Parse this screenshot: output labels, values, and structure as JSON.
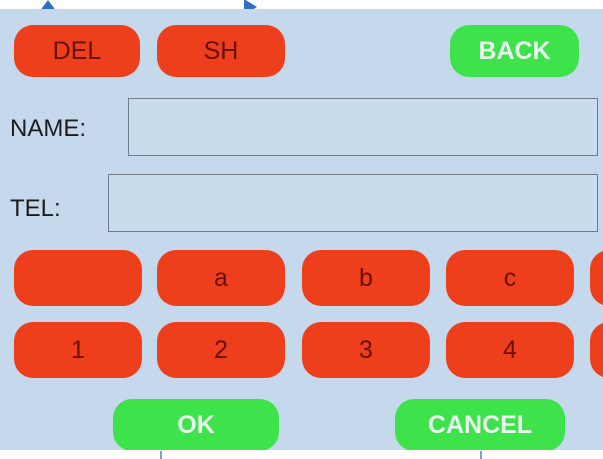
{
  "toolbar": {
    "del_label": "DEL",
    "sh_label": "SH",
    "back_label": "BACK"
  },
  "form": {
    "name_label": "NAME:",
    "name_value": "",
    "tel_label": "TEL:",
    "tel_value": ""
  },
  "keypad": {
    "row1": [
      "",
      "a",
      "b",
      "c"
    ],
    "row2": [
      "1",
      "2",
      "3",
      "4"
    ]
  },
  "actions": {
    "ok_label": "OK",
    "cancel_label": "CANCEL"
  },
  "colors": {
    "screen_bg": "#c6d9ec",
    "key_red": "#ee3f1c",
    "key_green": "#3ee34b",
    "annotation_arrow": "#2e6fbf"
  },
  "icons": [
    "annotation-arrow-up-icon",
    "annotation-arrow-right-icon"
  ]
}
